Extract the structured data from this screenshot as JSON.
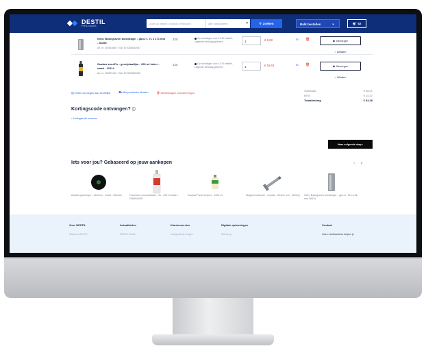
{
  "header": {
    "logo_name": "DESTIL",
    "logo_sub": "PROJUMAS",
    "search_placeholder": "Zoek op artikel, product, trefwoord",
    "category_placeholder": "Alle categorieën",
    "search_button": "Zoeken",
    "bulk_button": "Bulk bestellen",
    "cart_count": "52"
  },
  "cart": {
    "items": [
      {
        "name": "Gebr. Bodegraven borddrager - gbo-rl - 71 x 171 mm - 36495",
        "meta": "Art. nr. 300361658 · EAN 8710358362547",
        "quantity_note": "320",
        "availability": "Op werkdagen voor 21:30 besteld, volgende werkdag geleverd",
        "qty": "1",
        "price": "€ 9,28",
        "delivery_button": "Bezorgen",
        "pickup": "Afhalen"
      },
      {
        "name": "Zwaluw zoneFix - gevelplaatlijm - 290 ml koker - zwart - 10114",
        "meta": "Art. nr. 225873163 · EAN 8710563562654",
        "quantity_note": "120",
        "availability": "Op werkdagen voor 21:30 besteld, volgende werkdag geleverd",
        "qty": "1",
        "price": "€ 15,63",
        "delivery_button": "Bezorgen",
        "pickup": "Afhalen"
      }
    ],
    "actions": {
      "order_later": "Order toevoegen aan bestellijst",
      "pickup_all": "Alle producten afhalen",
      "clear_cart": "Winkelwagen compleet legen"
    },
    "totals": {
      "subtotal_label": "Subtotaal",
      "subtotal": "€ 68,91",
      "vat_label": "BTW",
      "vat": "€ 14,47",
      "total_label": "Totaalbedrag",
      "total": "€ 83,38"
    },
    "discount_title": "Kortingscode ontvangen?",
    "discount_link": "› Kortingscode invoeren",
    "next_button": "Naar volgende stap ›"
  },
  "recommendations": {
    "title": "Iets voor jou? Gebaseerd op jouw aankopen",
    "items": [
      {
        "name": "Zwaluw panehape - 12x2mm - zwart - 25meter"
      },
      {
        "name": "Franciam constructietam - fix - 290 ml koker - 2068000597"
      },
      {
        "name": "Zwaluw Panel cleaner - 1000 ml"
      },
      {
        "name": "Slagschroefanker - verpakt - 32x2,6 mm - (500st.)"
      },
      {
        "name": "Gebr. Bodegraven borddrager - gbo-zl - 59 x 166 mm 36534"
      }
    ]
  },
  "footer": {
    "columns": [
      {
        "title": "Over DESTIL",
        "link": "Waarom DESTIL"
      },
      {
        "title": "Actualiteiten",
        "link": "DESTIL Deals"
      },
      {
        "title": "Klantenservice",
        "link": "Veelgestelde vragen"
      },
      {
        "title": "Digitale oplossingen",
        "link": "Webshop"
      },
      {
        "title": "Contact",
        "link": "Onze medewerkers helpen je"
      }
    ]
  },
  "colors": {
    "brand_navy": "#0f2e7a",
    "accent_blue": "#2563e8",
    "price_red": "#e23a3a"
  }
}
